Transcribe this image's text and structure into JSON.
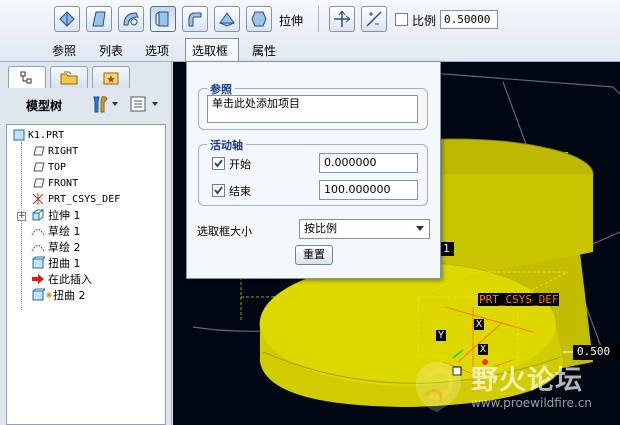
{
  "dashboard": {
    "extrude_label": "拉伸",
    "ratio_label": "比例",
    "ratio_value": "0.50000",
    "tabs": [
      "参照",
      "列表",
      "选项",
      "选取框",
      "属性"
    ]
  },
  "navigator": {
    "title": "模型树",
    "tree": [
      {
        "label": "K1.PRT",
        "icon": "part-icon"
      },
      {
        "label": "RIGHT",
        "icon": "datum-plane-icon"
      },
      {
        "label": "TOP",
        "icon": "datum-plane-icon"
      },
      {
        "label": "FRONT",
        "icon": "datum-plane-icon"
      },
      {
        "label": "PRT_CSYS_DEF",
        "icon": "csys-icon"
      },
      {
        "label": "拉伸 1",
        "icon": "extrude-icon"
      },
      {
        "label": "草绘 1",
        "icon": "sketch-icon"
      },
      {
        "label": "草绘 2",
        "icon": "sketch-icon"
      },
      {
        "label": "扭曲 1",
        "icon": "warp-icon"
      },
      {
        "label": "在此插入",
        "icon": "insert-arrow-icon"
      },
      {
        "label": "扭曲 2",
        "icon": "warp-icon"
      }
    ]
  },
  "panel": {
    "reference_title": "参照",
    "reference_placeholder": "单击此处添加项目",
    "axis_title": "活动轴",
    "start_label": "开始",
    "start_value": "0.000000",
    "end_label": "结束",
    "end_value": "100.000000",
    "size_label": "选取框大小",
    "size_option": "按比例",
    "reset_label": "重置"
  },
  "viewport": {
    "csys_label": "PRT_CSYS_DEF",
    "axis_x1": "X",
    "axis_x2": "X",
    "axis_y": "Y",
    "partial_value": "0.500",
    "partial_label": "1"
  },
  "watermark": {
    "cn": "野火论坛",
    "url": "www.proewildfire.cn"
  },
  "colors": {
    "model_yellow": "#d8d400",
    "viewport_bg": "#000612",
    "csys_orange": "#ff7a00",
    "group_title_blue": "#1a3d8f"
  }
}
